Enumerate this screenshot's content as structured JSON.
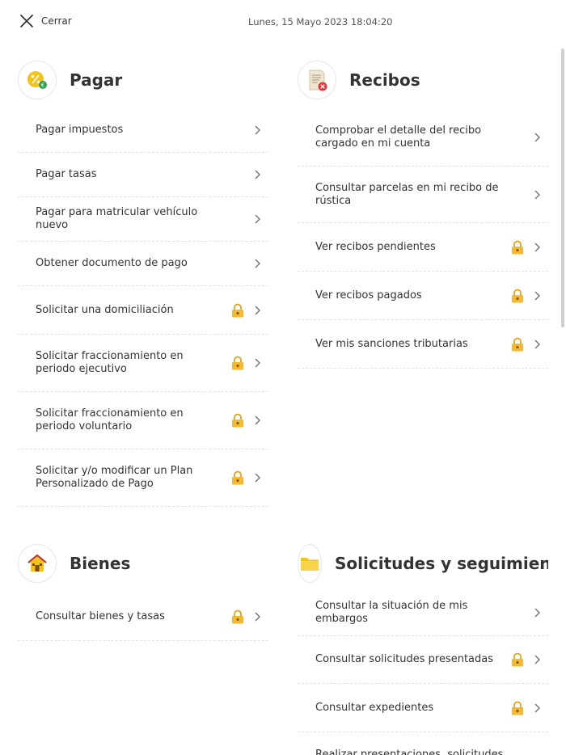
{
  "header": {
    "close_label": "Cerrar",
    "datetime": "Lunes, 15 Mayo 2023 18:04:20"
  },
  "colors": {
    "accent": "#f2b705",
    "lock": "#f5b82e",
    "close_red": "#e8333a",
    "divider": "#e3e3e3"
  },
  "sections": {
    "pagar": {
      "title": "Pagar",
      "icon": "percent-coin-icon",
      "items": [
        {
          "label": "Pagar impuestos",
          "locked": false
        },
        {
          "label": "Pagar tasas",
          "locked": false
        },
        {
          "label": "Pagar para matricular vehículo nuevo",
          "locked": false
        },
        {
          "label": "Obtener documento de pago",
          "locked": false
        },
        {
          "label": "Solicitar una domiciliación",
          "locked": true
        },
        {
          "label": "Solicitar fraccionamiento en periodo ejecutivo",
          "locked": true
        },
        {
          "label": "Solicitar fraccionamiento en periodo voluntario",
          "locked": true
        },
        {
          "label": "Solicitar y/o modificar un Plan Personalizado de Pago",
          "locked": true
        }
      ]
    },
    "recibos": {
      "title": "Recibos",
      "icon": "receipt-icon",
      "items": [
        {
          "label": "Comprobar el detalle del recibo cargado en mi cuenta",
          "locked": false
        },
        {
          "label": "Consultar parcelas en mi recibo de rústica",
          "locked": false
        },
        {
          "label": "Ver recibos pendientes",
          "locked": true
        },
        {
          "label": "Ver recibos pagados",
          "locked": true
        },
        {
          "label": "Ver mis sanciones tributarias",
          "locked": true
        }
      ]
    },
    "bienes": {
      "title": "Bienes",
      "icon": "house-icon",
      "items": [
        {
          "label": "Consultar bienes y tasas",
          "locked": true
        }
      ]
    },
    "solicitudes": {
      "title": "Solicitudes y seguimiento",
      "icon": "folder-icon",
      "items": [
        {
          "label": "Consultar la situación de mis embargos",
          "locked": false
        },
        {
          "label": "Consultar solicitudes presentadas",
          "locked": true
        },
        {
          "label": "Consultar expedientes",
          "locked": true
        },
        {
          "label": "Realizar presentaciones, solicitudes",
          "locked": false
        }
      ]
    }
  }
}
